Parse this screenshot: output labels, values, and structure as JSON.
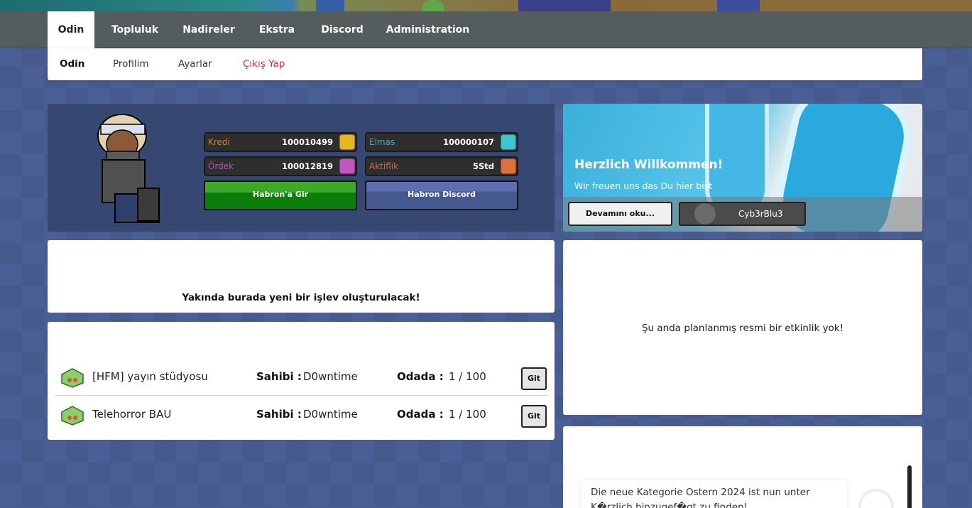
{
  "main_nav": [
    "Odin",
    "Topluluk",
    "Nadireler",
    "Ekstra",
    "Discord",
    "Administration"
  ],
  "sub_nav": [
    "Odin",
    "Profilim",
    "Ayarlar",
    "Çıkış Yap"
  ],
  "stats": {
    "kredi": {
      "label": "Kredi",
      "value": "100010499",
      "color": "#c98a1e",
      "icon": "coin-icon"
    },
    "elmas": {
      "label": "Elmas",
      "value": "100000107",
      "color": "#2fb4c8",
      "icon": "diamond-icon"
    },
    "ordek": {
      "label": "Ördek",
      "value": "100012819",
      "color": "#c04fc0",
      "icon": "duck-icon"
    },
    "aktiflik": {
      "label": "Aktiflik",
      "value": "5Std",
      "color": "#d96a36",
      "icon": "alarm-clock-icon"
    }
  },
  "buttons": {
    "enter": "Habron'a Gir",
    "discord": "Habron Discord",
    "more": "Devamını oku...",
    "go": "Git"
  },
  "welcome": {
    "title": "Herzlich Willkommen!",
    "subtitle": "Wir freuen uns das Du hier bist",
    "username": "Cyb3rBlu3"
  },
  "coming_soon": "Yakında burada yeni bir işlev oluşturulacak!",
  "rooms": [
    {
      "name": "[HFM] yayın stüdyosu",
      "owner_label": "Sahibi :",
      "owner": "D0wntime",
      "count_label": "Odada :",
      "count": "1 / 100"
    },
    {
      "name": "Telehorror BAU",
      "owner_label": "Sahibi :",
      "owner": "D0wntime",
      "count_label": "Odada :",
      "count": "1 / 100"
    }
  ],
  "events_message": "Şu anda planlanmış resmi bir etkinlik yok!",
  "news_text": "Die neue Kategorie Ostern 2024 ist nun unter K�rzlich hinzugef�gt zu finden!",
  "colors": {
    "enter_button": "#0f8c0f",
    "discord_button": "#4a5d96",
    "logout": "#e0262a",
    "nav": "#555c5e"
  }
}
